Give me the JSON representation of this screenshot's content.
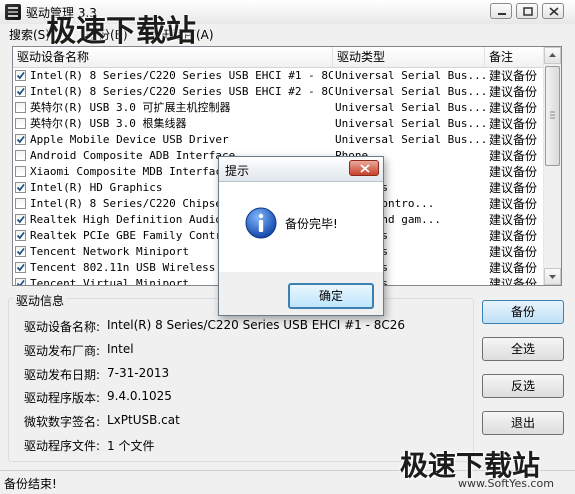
{
  "window": {
    "title": "驱动管理 3.3"
  },
  "menu": [
    "搜索(S)",
    "备份(B)",
    "关于程序(A)"
  ],
  "list": {
    "headers": [
      "驱动设备名称",
      "驱动类型",
      "备注"
    ],
    "rows": [
      {
        "checked": true,
        "name": "Intel(R) 8 Series/C220 Series USB EHCI #1 - 8C26",
        "type": "Universal Serial Bus...",
        "note": "建议备份"
      },
      {
        "checked": true,
        "name": "Intel(R) 8 Series/C220 Series USB EHCI #2 - 8C2D",
        "type": "Universal Serial Bus...",
        "note": "建议备份"
      },
      {
        "checked": false,
        "name": "英特尔(R) USB 3.0 可扩展主机控制器",
        "type": "Universal Serial Bus...",
        "note": "建议备份"
      },
      {
        "checked": false,
        "name": "英特尔(R) USB 3.0 根集线器",
        "type": "Universal Serial Bus...",
        "note": "建议备份"
      },
      {
        "checked": true,
        "name": "Apple Mobile Device USB Driver",
        "type": "Universal Serial Bus...",
        "note": "建议备份"
      },
      {
        "checked": false,
        "name": "Android Composite ADB Interface",
        "type": "Phone",
        "note": "建议备份"
      },
      {
        "checked": false,
        "name": "Xiaomi Composite MDB Interface",
        "type": "Phone",
        "note": "建议备份"
      },
      {
        "checked": true,
        "name": "Intel(R) HD Graphics",
        "type": "adapters",
        "note": "建议备份"
      },
      {
        "checked": false,
        "name": "Intel(R) 8 Series/C220 Chipset",
        "type": "ATAPI contro...",
        "note": "建议备份"
      },
      {
        "checked": true,
        "name": "Realtek High Definition Audio",
        "type": "video and gam...",
        "note": "建议备份"
      },
      {
        "checked": true,
        "name": "Realtek PCIe GBE Family Control",
        "type": "adapters",
        "note": "建议备份"
      },
      {
        "checked": true,
        "name": "Tencent Network Miniport",
        "type": "adapters",
        "note": "建议备份"
      },
      {
        "checked": true,
        "name": "Tencent 802.11n USB Wireless Ad",
        "type": "adapters",
        "note": "建议备份"
      },
      {
        "checked": true,
        "name": "Tencent Virtual Miniport",
        "type": "adapters",
        "note": "建议备份"
      }
    ]
  },
  "info": {
    "title": "驱动信息",
    "rows": [
      {
        "label": "驱动设备名称:",
        "value": "Intel(R) 8 Series/C220 Series USB EHCI #1 - 8C26"
      },
      {
        "label": "驱动发布厂商:",
        "value": "Intel"
      },
      {
        "label": "驱动发布日期:",
        "value": "7-31-2013"
      },
      {
        "label": "驱动程序版本:",
        "value": "9.4.0.1025"
      },
      {
        "label": "微软数字签名:",
        "value": "LxPtUSB.cat"
      },
      {
        "label": "驱动程序文件:",
        "value": "1 个文件"
      }
    ]
  },
  "buttons": {
    "backup": "备份",
    "select_all": "全选",
    "invert": "反选",
    "exit": "退出"
  },
  "status": "备份结束!",
  "dialog": {
    "title": "提示",
    "message": "备份完毕!",
    "ok": "确定"
  },
  "watermark": {
    "text": "极速下载站",
    "url": "www.SoftYes.com"
  },
  "colors": {
    "accent": "#3c7fb1",
    "check": "#1d4e89",
    "close": "#c8412b"
  }
}
